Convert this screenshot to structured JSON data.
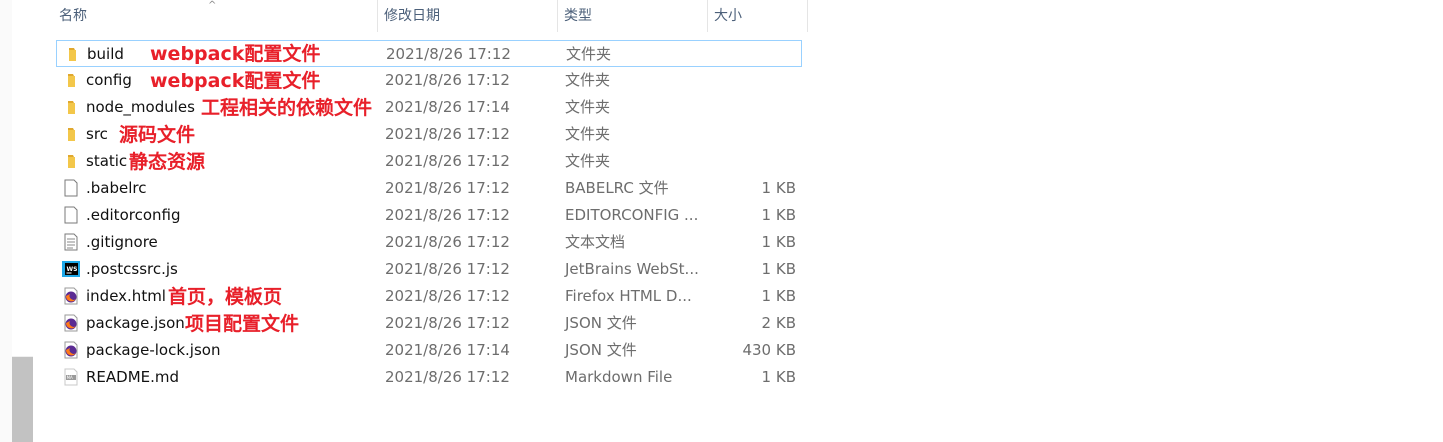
{
  "header": {
    "name": "名称",
    "modified": "修改日期",
    "type": "类型",
    "size": "大小",
    "sort_arrow": "^"
  },
  "files": [
    {
      "name": "build",
      "date": "2021/8/26 17:12",
      "type": "文件夹",
      "size": "",
      "icon": "folder-icon",
      "note": "webpack配置文件"
    },
    {
      "name": "config",
      "date": "2021/8/26 17:12",
      "type": "文件夹",
      "size": "",
      "icon": "folder-icon",
      "note": "webpack配置文件"
    },
    {
      "name": "node_modules",
      "date": "2021/8/26 17:14",
      "type": "文件夹",
      "size": "",
      "icon": "folder-icon",
      "note": "工程相关的依赖文件"
    },
    {
      "name": "src",
      "date": "2021/8/26 17:12",
      "type": "文件夹",
      "size": "",
      "icon": "folder-icon",
      "note": "源码文件"
    },
    {
      "name": "static",
      "date": "2021/8/26 17:12",
      "type": "文件夹",
      "size": "",
      "icon": "folder-icon",
      "note": "静态资源"
    },
    {
      "name": ".babelrc",
      "date": "2021/8/26 17:12",
      "type": "BABELRC 文件",
      "size": "1 KB",
      "icon": "blank-file-icon",
      "note": ""
    },
    {
      "name": ".editorconfig",
      "date": "2021/8/26 17:12",
      "type": "EDITORCONFIG ...",
      "size": "1 KB",
      "icon": "blank-file-icon",
      "note": ""
    },
    {
      "name": ".gitignore",
      "date": "2021/8/26 17:12",
      "type": "文本文档",
      "size": "1 KB",
      "icon": "text-file-icon",
      "note": ""
    },
    {
      "name": ".postcssrc.js",
      "date": "2021/8/26 17:12",
      "type": "JetBrains WebSt...",
      "size": "1 KB",
      "icon": "webstorm-icon",
      "note": ""
    },
    {
      "name": "index.html",
      "date": "2021/8/26 17:12",
      "type": "Firefox HTML D...",
      "size": "1 KB",
      "icon": "firefox-file-icon",
      "note": "首页，模板页"
    },
    {
      "name": "package.json",
      "date": "2021/8/26 17:12",
      "type": "JSON 文件",
      "size": "2 KB",
      "icon": "firefox-file-icon",
      "note": "项目配置文件"
    },
    {
      "name": "package-lock.json",
      "date": "2021/8/26 17:14",
      "type": "JSON 文件",
      "size": "430 KB",
      "icon": "firefox-file-icon",
      "note": ""
    },
    {
      "name": "README.md",
      "date": "2021/8/26 17:12",
      "type": "Markdown File",
      "size": "1 KB",
      "icon": "markdown-file-icon",
      "note": ""
    }
  ],
  "colors": {
    "annotation": "#e8202a",
    "selection_border": "#99d1ff",
    "header_text": "#4c607a",
    "folder": "#f3c74a"
  }
}
